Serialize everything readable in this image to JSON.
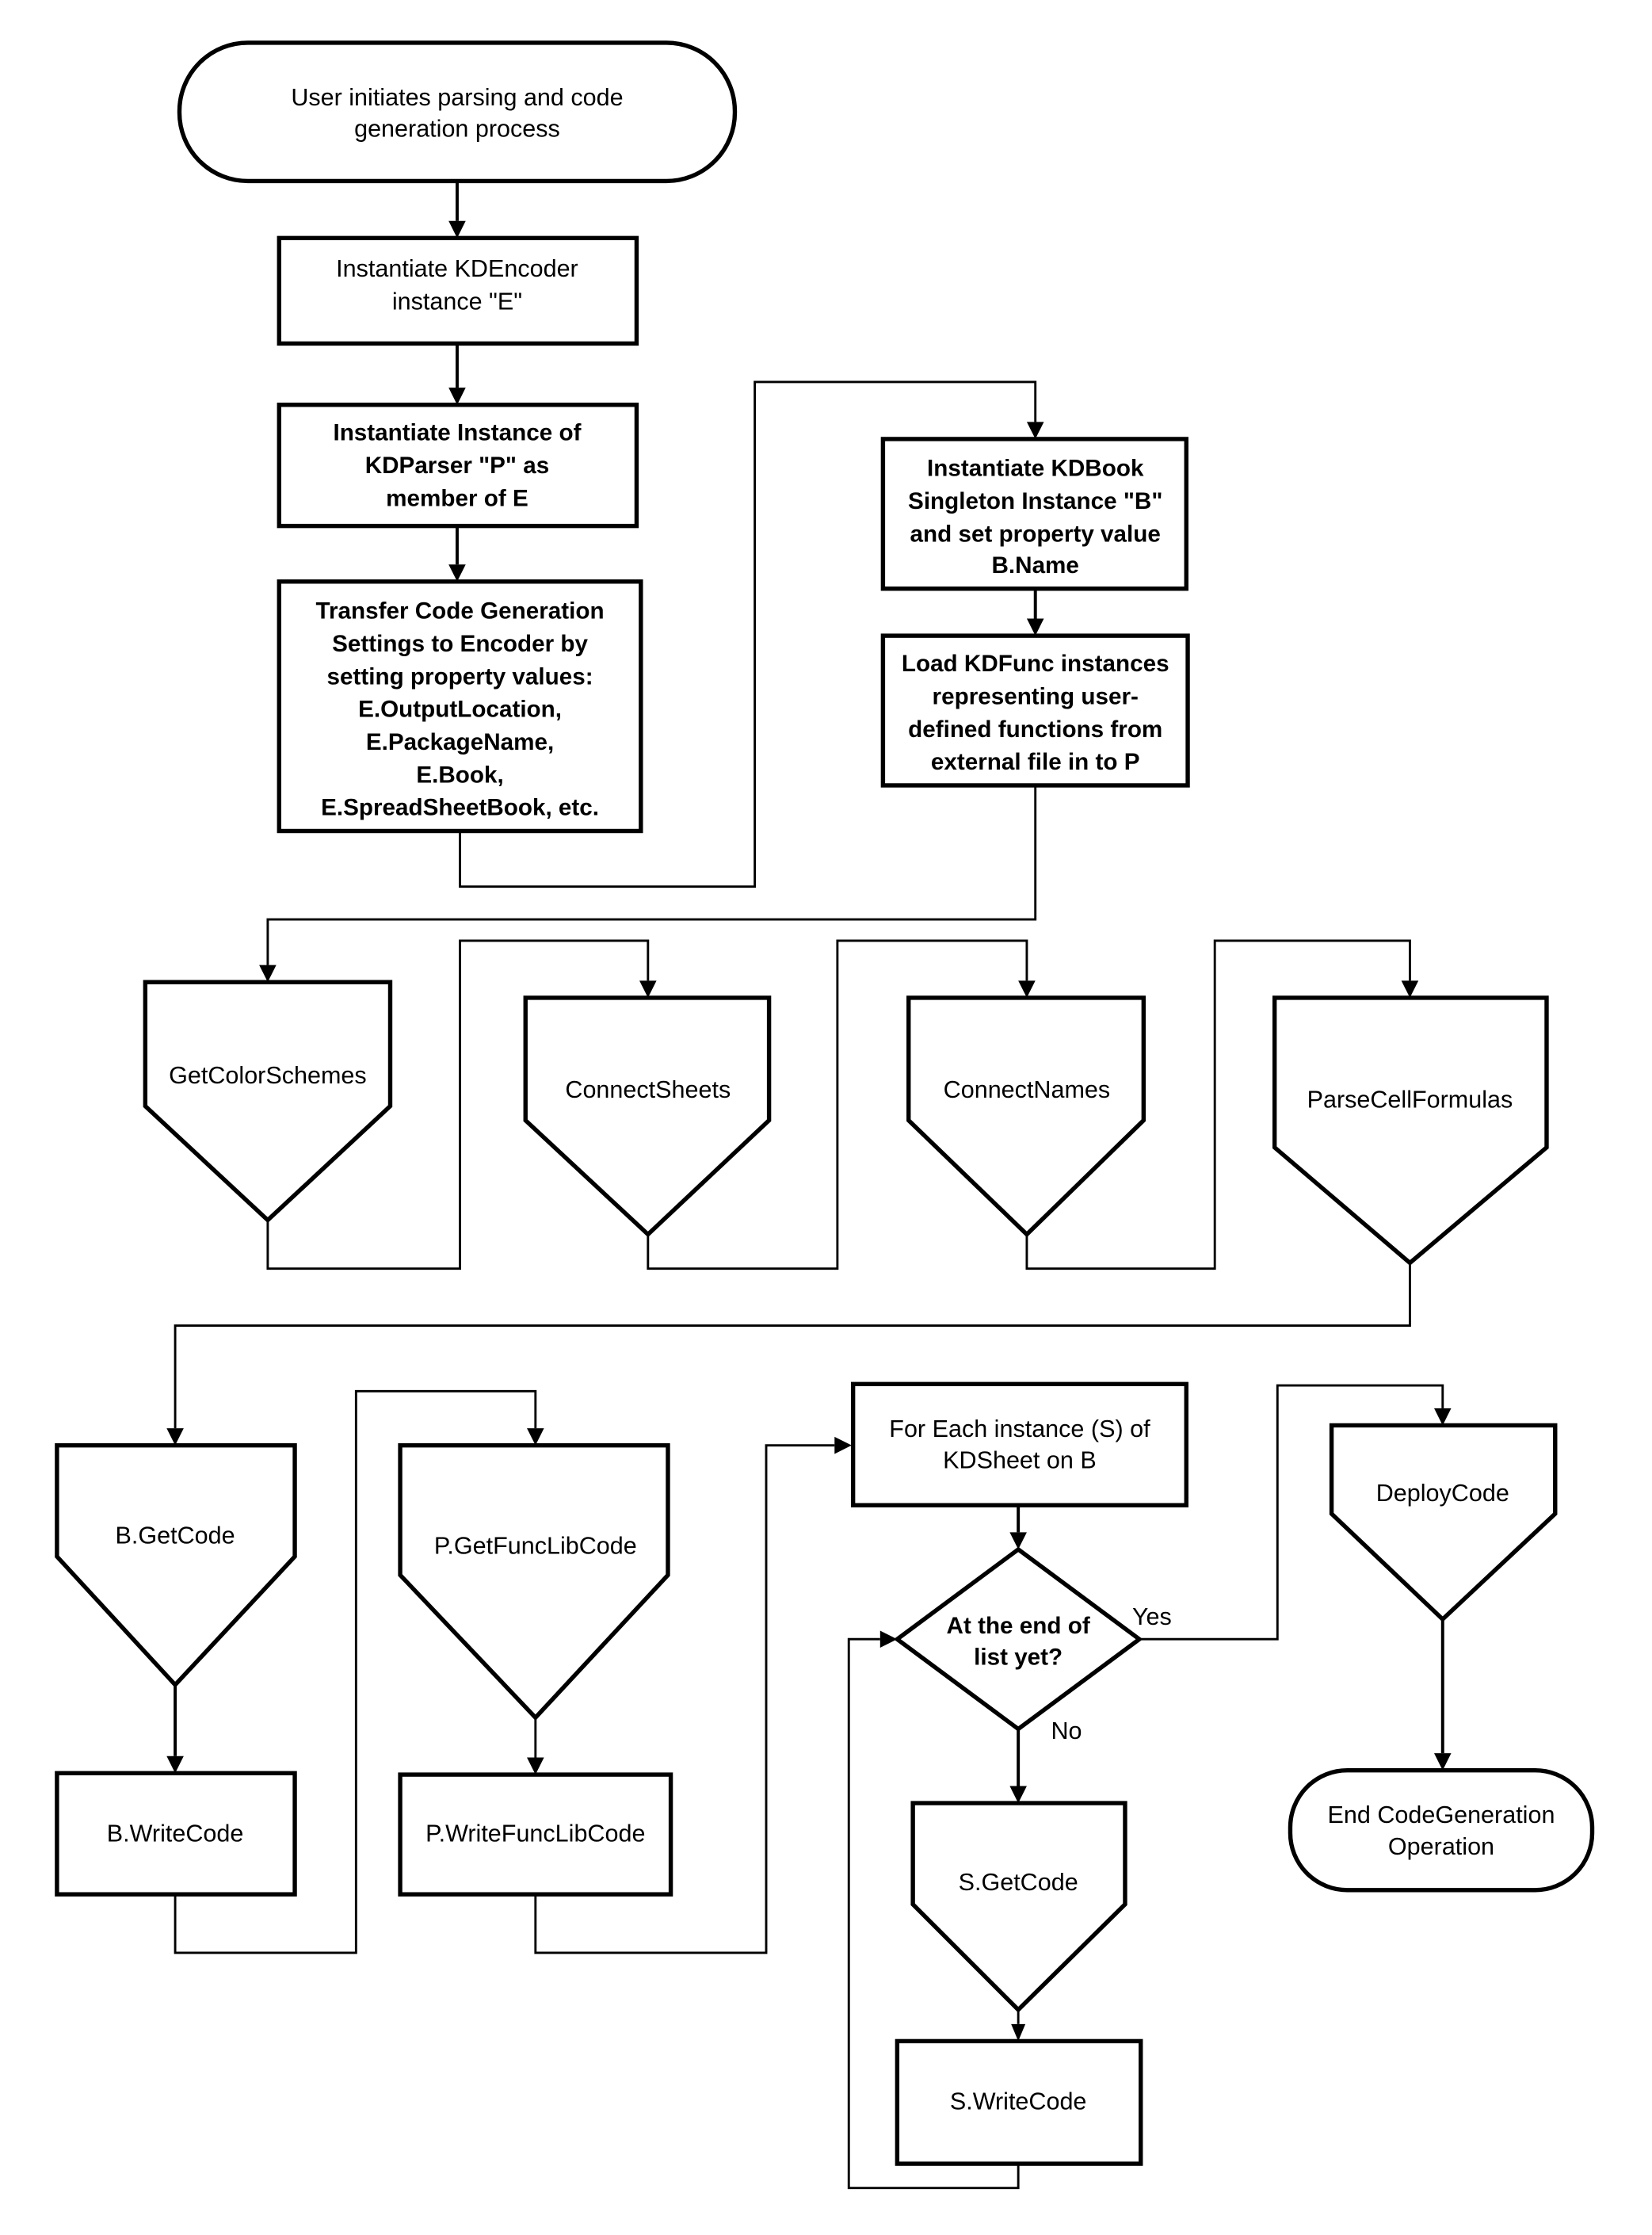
{
  "diagram": {
    "type": "flowchart",
    "nodes": {
      "start": {
        "shape": "terminator",
        "lines": [
          "User initiates parsing and code",
          "generation process"
        ]
      },
      "instantiate_encoder": {
        "shape": "process",
        "lines": [
          "Instantiate KDEncoder",
          "instance \"E\""
        ]
      },
      "instantiate_parser": {
        "shape": "process",
        "lines": [
          "Instantiate Instance of",
          "KDParser \"P\" as",
          "member of E"
        ]
      },
      "transfer_settings": {
        "shape": "process",
        "lines": [
          "Transfer Code Generation",
          "Settings to Encoder by",
          "setting property values:",
          "E.OutputLocation,",
          "E.PackageName,",
          "E.Book,",
          "E.SpreadSheetBook, etc."
        ]
      },
      "instantiate_book": {
        "shape": "process",
        "lines": [
          "Instantiate KDBook",
          "Singleton Instance \"B\"",
          "and set property value",
          "B.Name"
        ]
      },
      "load_funcs": {
        "shape": "process",
        "lines": [
          "Load KDFunc instances",
          "representing user-",
          "defined functions from",
          "external file in to P"
        ]
      },
      "get_color_schemes": {
        "shape": "offpage",
        "lines": [
          "GetColorSchemes"
        ]
      },
      "connect_sheets": {
        "shape": "offpage",
        "lines": [
          "ConnectSheets"
        ]
      },
      "connect_names": {
        "shape": "offpage",
        "lines": [
          "ConnectNames"
        ]
      },
      "parse_cell_formulas": {
        "shape": "offpage",
        "lines": [
          "ParseCellFormulas"
        ]
      },
      "b_get_code": {
        "shape": "offpage",
        "lines": [
          "B.GetCode"
        ]
      },
      "b_write_code": {
        "shape": "process",
        "lines": [
          "B.WriteCode"
        ]
      },
      "p_get_func_lib_code": {
        "shape": "offpage",
        "lines": [
          "P.GetFuncLibCode"
        ]
      },
      "p_write_func_lib_code": {
        "shape": "process",
        "lines": [
          "P.WriteFuncLibCode"
        ]
      },
      "for_each_sheet": {
        "shape": "process",
        "lines": [
          "For Each instance (S) of",
          "KDSheet on B"
        ]
      },
      "end_of_list": {
        "shape": "decision",
        "lines": [
          "At the end of",
          "list yet?"
        ]
      },
      "s_get_code": {
        "shape": "offpage",
        "lines": [
          "S.GetCode"
        ]
      },
      "s_write_code": {
        "shape": "process",
        "lines": [
          "S.WriteCode"
        ]
      },
      "deploy_code": {
        "shape": "offpage",
        "lines": [
          "DeployCode"
        ]
      },
      "end": {
        "shape": "terminator",
        "lines": [
          "End CodeGeneration",
          "Operation"
        ]
      }
    },
    "edges": [
      {
        "from": "start",
        "to": "instantiate_encoder"
      },
      {
        "from": "instantiate_encoder",
        "to": "instantiate_parser"
      },
      {
        "from": "instantiate_parser",
        "to": "transfer_settings"
      },
      {
        "from": "transfer_settings",
        "to": "instantiate_book"
      },
      {
        "from": "instantiate_book",
        "to": "load_funcs"
      },
      {
        "from": "load_funcs",
        "to": "get_color_schemes"
      },
      {
        "from": "get_color_schemes",
        "to": "connect_sheets"
      },
      {
        "from": "connect_sheets",
        "to": "connect_names"
      },
      {
        "from": "connect_names",
        "to": "parse_cell_formulas"
      },
      {
        "from": "parse_cell_formulas",
        "to": "b_get_code"
      },
      {
        "from": "b_get_code",
        "to": "b_write_code"
      },
      {
        "from": "b_write_code",
        "to": "p_get_func_lib_code"
      },
      {
        "from": "p_get_func_lib_code",
        "to": "p_write_func_lib_code"
      },
      {
        "from": "p_write_func_lib_code",
        "to": "for_each_sheet"
      },
      {
        "from": "for_each_sheet",
        "to": "end_of_list"
      },
      {
        "from": "end_of_list",
        "to": "deploy_code",
        "label": "Yes"
      },
      {
        "from": "end_of_list",
        "to": "s_get_code",
        "label": "No"
      },
      {
        "from": "s_get_code",
        "to": "s_write_code"
      },
      {
        "from": "s_write_code",
        "to": "end_of_list"
      },
      {
        "from": "deploy_code",
        "to": "end"
      }
    ],
    "edge_labels": {
      "yes": "Yes",
      "no": "No"
    }
  }
}
